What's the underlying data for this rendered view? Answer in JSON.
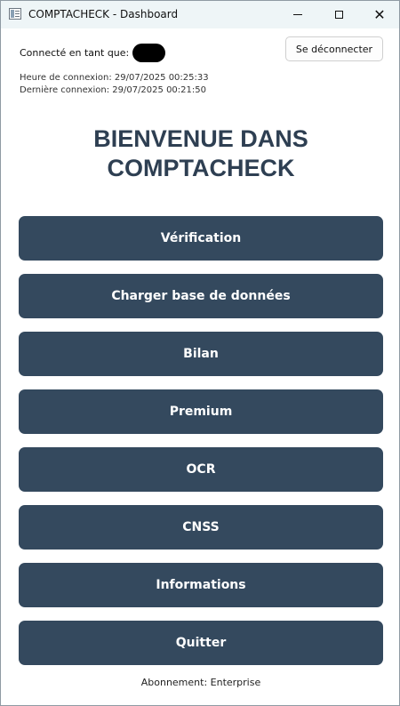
{
  "window": {
    "title": "COMPTACHECK - Dashboard",
    "minimize_glyph": "",
    "maximize_glyph": "",
    "close_glyph": "✕"
  },
  "header": {
    "connected_label": "Connecté en tant que:",
    "logout_label": "Se déconnecter",
    "login_time": "Heure de connexion: 29/07/2025 00:25:33",
    "last_login": "Dernière connexion: 29/07/2025 00:21:50"
  },
  "main": {
    "title_line1": "BIENVENUE DANS",
    "title_line2": "COMPTACHECK"
  },
  "menu": {
    "items": [
      {
        "label": "Vérification"
      },
      {
        "label": "Charger base de données"
      },
      {
        "label": "Bilan"
      },
      {
        "label": "Premium"
      },
      {
        "label": "OCR"
      },
      {
        "label": "CNSS"
      },
      {
        "label": "Informations"
      },
      {
        "label": "Quitter"
      }
    ]
  },
  "footer": {
    "subscription": "Abonnement: Enterprise"
  },
  "colors": {
    "button_bg": "#34495e",
    "title_color": "#2e3f52",
    "titlebar_bg": "#eef5f7"
  }
}
